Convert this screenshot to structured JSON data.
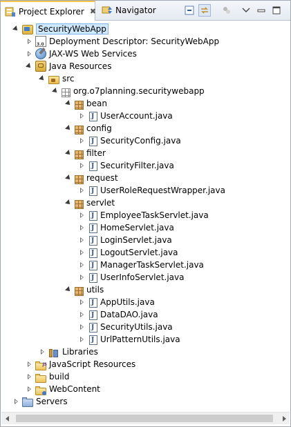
{
  "tabs": [
    {
      "label": "Project Explorer",
      "icon": "project-explorer-icon",
      "close": "✖"
    },
    {
      "label": "Navigator",
      "icon": "navigator-icon"
    }
  ],
  "toolbar": {
    "buttons": [
      "collapse-all-icon",
      "link-with-editor-icon",
      "view-options-icon",
      "view-menu-icon",
      "minimize-icon",
      "maximize-icon"
    ]
  },
  "tree": [
    {
      "label": "SecurityWebApp",
      "depth": 0,
      "twisty": "open",
      "icon": "project-icon",
      "selected": true
    },
    {
      "label": "Deployment Descriptor: SecurityWebApp",
      "depth": 1,
      "twisty": "closed",
      "icon": "deployment-descriptor-icon"
    },
    {
      "label": "JAX-WS Web Services",
      "depth": 1,
      "twisty": "closed",
      "icon": "web-services-icon"
    },
    {
      "label": "Java Resources",
      "depth": 1,
      "twisty": "open",
      "icon": "java-resources-icon"
    },
    {
      "label": "src",
      "depth": 2,
      "twisty": "open",
      "icon": "source-folder-icon"
    },
    {
      "label": "org.o7planning.securitywebapp",
      "depth": 3,
      "twisty": "open",
      "icon": "empty-package-icon"
    },
    {
      "label": "bean",
      "depth": 4,
      "twisty": "open",
      "icon": "package-icon"
    },
    {
      "label": "UserAccount.java",
      "depth": 5,
      "twisty": "closed",
      "icon": "java-file-icon"
    },
    {
      "label": "config",
      "depth": 4,
      "twisty": "open",
      "icon": "package-icon"
    },
    {
      "label": "SecurityConfig.java",
      "depth": 5,
      "twisty": "closed",
      "icon": "java-file-icon"
    },
    {
      "label": "filter",
      "depth": 4,
      "twisty": "open",
      "icon": "package-icon"
    },
    {
      "label": "SecurityFilter.java",
      "depth": 5,
      "twisty": "closed",
      "icon": "java-file-icon"
    },
    {
      "label": "request",
      "depth": 4,
      "twisty": "open",
      "icon": "package-icon"
    },
    {
      "label": "UserRoleRequestWrapper.java",
      "depth": 5,
      "twisty": "closed",
      "icon": "java-file-icon"
    },
    {
      "label": "servlet",
      "depth": 4,
      "twisty": "open",
      "icon": "package-icon"
    },
    {
      "label": "EmployeeTaskServlet.java",
      "depth": 5,
      "twisty": "closed",
      "icon": "java-file-icon"
    },
    {
      "label": "HomeServlet.java",
      "depth": 5,
      "twisty": "closed",
      "icon": "java-file-icon"
    },
    {
      "label": "LoginServlet.java",
      "depth": 5,
      "twisty": "closed",
      "icon": "java-file-icon"
    },
    {
      "label": "LogoutServlet.java",
      "depth": 5,
      "twisty": "closed",
      "icon": "java-file-icon"
    },
    {
      "label": "ManagerTaskServlet.java",
      "depth": 5,
      "twisty": "closed",
      "icon": "java-file-icon"
    },
    {
      "label": "UserInfoServlet.java",
      "depth": 5,
      "twisty": "closed",
      "icon": "java-file-icon"
    },
    {
      "label": "utils",
      "depth": 4,
      "twisty": "open",
      "icon": "package-icon"
    },
    {
      "label": "AppUtils.java",
      "depth": 5,
      "twisty": "closed",
      "icon": "java-file-icon"
    },
    {
      "label": "DataDAO.java",
      "depth": 5,
      "twisty": "closed",
      "icon": "java-file-icon"
    },
    {
      "label": "SecurityUtils.java",
      "depth": 5,
      "twisty": "closed",
      "icon": "java-file-icon"
    },
    {
      "label": "UrlPatternUtils.java",
      "depth": 5,
      "twisty": "closed",
      "icon": "java-file-icon"
    },
    {
      "label": "Libraries",
      "depth": 2,
      "twisty": "closed",
      "icon": "libraries-icon"
    },
    {
      "label": "JavaScript Resources",
      "depth": 1,
      "twisty": "closed",
      "icon": "javascript-resources-icon"
    },
    {
      "label": "build",
      "depth": 1,
      "twisty": "closed",
      "icon": "folder-icon"
    },
    {
      "label": "WebContent",
      "depth": 1,
      "twisty": "closed",
      "icon": "web-content-folder-icon"
    },
    {
      "label": "Servers",
      "depth": 0,
      "twisty": "closed",
      "icon": "servers-folder-icon"
    }
  ],
  "colors": {
    "selection_bg": "#cde8ff",
    "selection_border": "#7eb4ea",
    "active_tab_accent": "#f5c74f"
  }
}
